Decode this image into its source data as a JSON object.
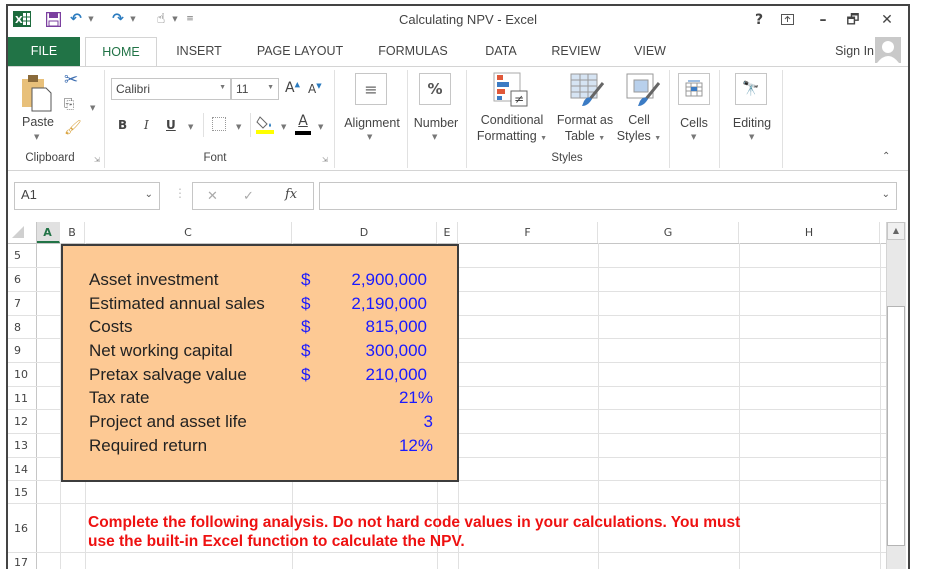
{
  "window": {
    "title": "Calculating NPV - Excel",
    "help_label": "?",
    "sign_in_label": "Sign In"
  },
  "quick_access": {
    "icons": [
      "excel-logo-icon",
      "save-icon",
      "undo-icon",
      "redo-icon",
      "touch-mode-icon",
      "customize-qat-icon"
    ]
  },
  "tabs": [
    {
      "label": "FILE"
    },
    {
      "label": "HOME",
      "active": true
    },
    {
      "label": "INSERT"
    },
    {
      "label": "PAGE LAYOUT"
    },
    {
      "label": "FORMULAS"
    },
    {
      "label": "DATA"
    },
    {
      "label": "REVIEW"
    },
    {
      "label": "VIEW"
    }
  ],
  "ribbon": {
    "clipboard": {
      "paste_label": "Paste",
      "group_label": "Clipboard"
    },
    "font": {
      "font_name": "Calibri",
      "font_size": "11",
      "bold_label": "B",
      "italic_label": "I",
      "underline_label": "U",
      "font_color_label": "A",
      "grow_label": "A",
      "shrink_label": "A",
      "group_label": "Font",
      "fill_color": "#ffff00",
      "font_color": "#000000"
    },
    "alignment_label": "Alignment",
    "number_label": "Number",
    "number_icon": "%",
    "styles": {
      "conditional_line1": "Conditional",
      "conditional_line2": "Formatting",
      "format_table_line1": "Format as",
      "format_table_line2": "Table",
      "cell_styles_line1": "Cell",
      "cell_styles_line2": "Styles",
      "group_label": "Styles"
    },
    "cells_label": "Cells",
    "editing_label": "Editing"
  },
  "formula_bar": {
    "name_box": "A1",
    "fx_label": "fx",
    "formula_value": ""
  },
  "grid": {
    "columns": [
      "A",
      "B",
      "C",
      "D",
      "E",
      "F",
      "G",
      "H"
    ],
    "rows": [
      "5",
      "6",
      "7",
      "8",
      "9",
      "10",
      "11",
      "12",
      "13",
      "14",
      "15",
      "16",
      "17"
    ],
    "selected_cell": "A1"
  },
  "inputs": [
    {
      "label": "Asset investment",
      "currency": "$",
      "value": "2,900,000"
    },
    {
      "label": "Estimated annual sales",
      "currency": "$",
      "value": "2,190,000"
    },
    {
      "label": "Costs",
      "currency": "$",
      "value": "815,000"
    },
    {
      "label": "Net working capital",
      "currency": "$",
      "value": "300,000"
    },
    {
      "label": "Pretax salvage value",
      "currency": "$",
      "value": "210,000"
    },
    {
      "label": "Tax rate",
      "currency": "",
      "value": "21%"
    },
    {
      "label": "Project and asset life",
      "currency": "",
      "value": "3"
    },
    {
      "label": "Required return",
      "currency": "",
      "value": "12%"
    }
  ],
  "instruction": {
    "line1": "Complete the following analysis. Do not hard code values in your calculations. You must",
    "line2": "use the built-in Excel function to calculate the NPV."
  },
  "colors": {
    "excel_green": "#217346",
    "input_box_fill": "#fdc994",
    "input_value_blue": "#1a1aff",
    "instruction_red": "#ee1111"
  }
}
